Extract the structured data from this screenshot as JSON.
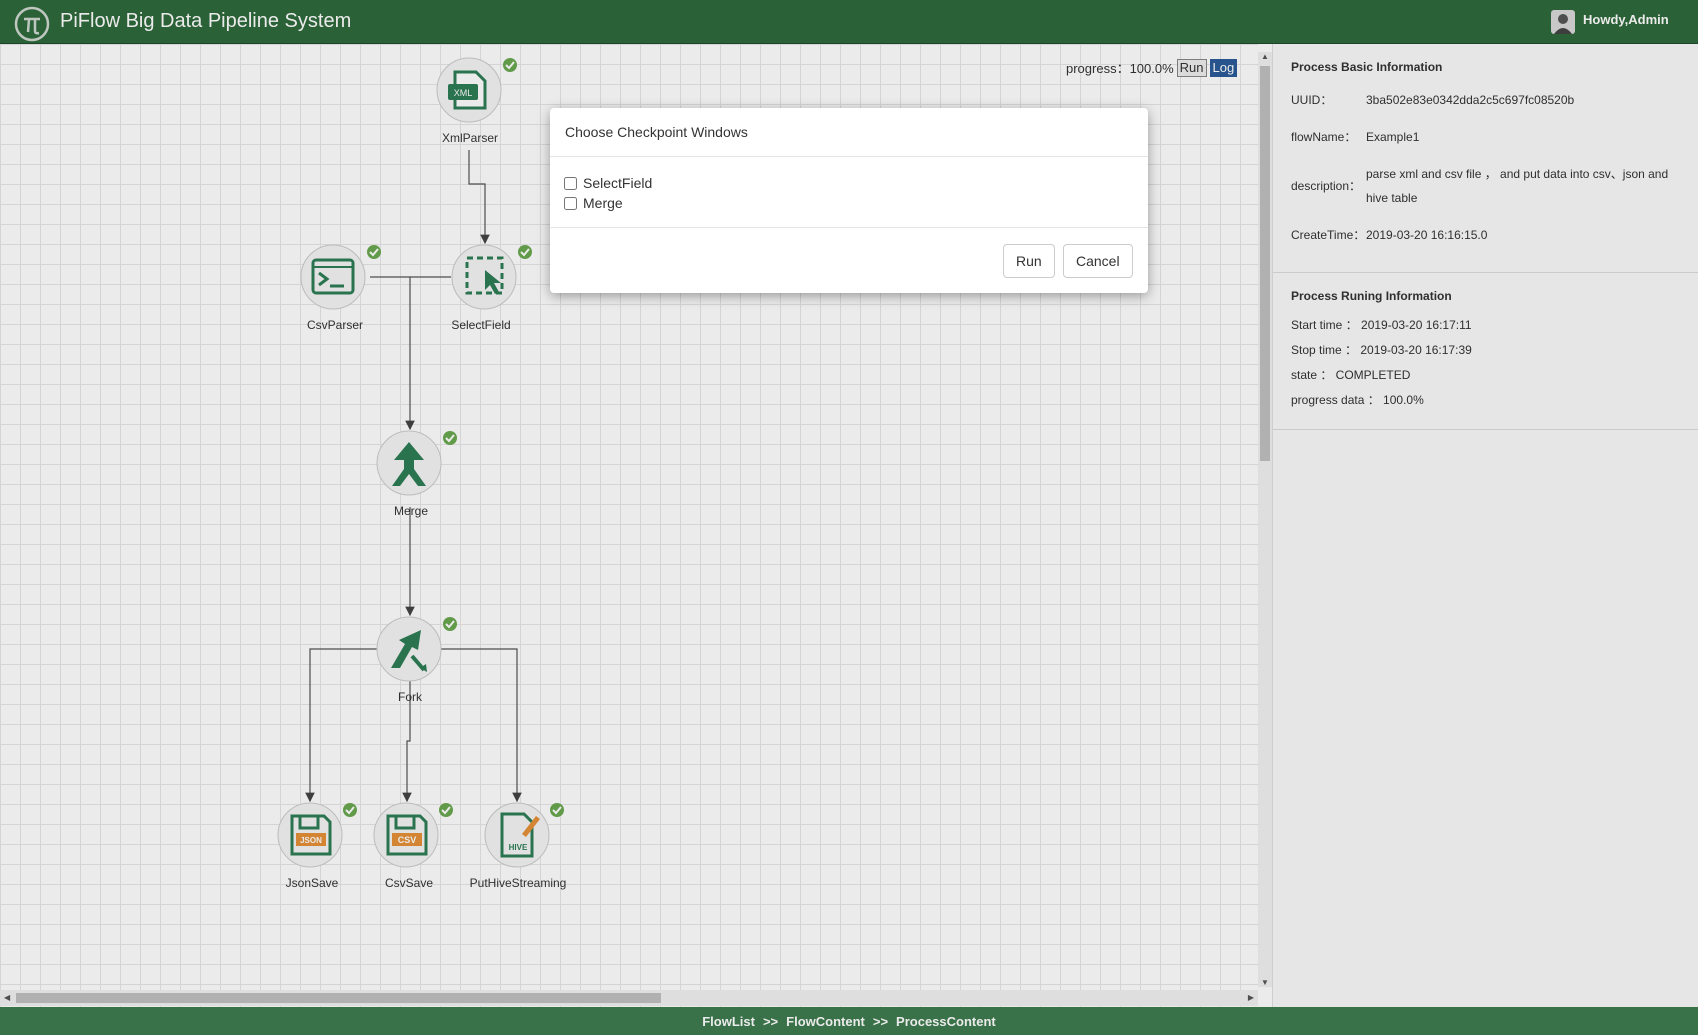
{
  "header": {
    "title": "PiFlow Big Data Pipeline System",
    "greeting": "Howdy,Admin"
  },
  "canvas": {
    "progress_label": "progress：100.0%",
    "run_label": "Run",
    "log_label": "Log",
    "nodes": [
      {
        "name": "XmlParser",
        "icon": "xml-file-icon",
        "status": "done"
      },
      {
        "name": "CsvParser",
        "icon": "terminal-icon",
        "status": "done"
      },
      {
        "name": "SelectField",
        "icon": "select-cursor-icon",
        "status": "done"
      },
      {
        "name": "Merge",
        "icon": "merge-icon",
        "status": "done"
      },
      {
        "name": "Fork",
        "icon": "fork-icon",
        "status": "done"
      },
      {
        "name": "JsonSave",
        "icon": "json-save-icon",
        "status": "done"
      },
      {
        "name": "CsvSave",
        "icon": "csv-save-icon",
        "status": "done"
      },
      {
        "name": "PutHiveStreaming",
        "icon": "hive-icon",
        "status": "done"
      }
    ],
    "edges": [
      [
        "XmlParser",
        "SelectField"
      ],
      [
        "CsvParser",
        "Merge"
      ],
      [
        "SelectField",
        "Merge"
      ],
      [
        "Merge",
        "Fork"
      ],
      [
        "Fork",
        "JsonSave"
      ],
      [
        "Fork",
        "CsvSave"
      ],
      [
        "Fork",
        "PutHiveStreaming"
      ]
    ],
    "icon_text": {
      "xml": "XML",
      "json": "JSON",
      "csv": "CSV",
      "hive": "HIVE"
    }
  },
  "info": {
    "basic_title": "Process Basic Information",
    "uuid_label": "UUID：",
    "uuid": "3ba502e83e0342dda2c5c697fc08520b",
    "flowname_label": "flowName：",
    "flowname": "Example1",
    "description_label": "description：",
    "description": "parse xml and csv file ， and put data into csv、json and hive table",
    "createtime_label": "CreateTime：",
    "createtime": "2019-03-20 16:16:15.0",
    "running_title": "Process Runing Information",
    "start_time": "Start time ： 2019-03-20 16:17:11",
    "stop_time": "Stop time ： 2019-03-20 16:17:39",
    "state": "state ： COMPLETED",
    "progress": "progress data ： 100.0%"
  },
  "modal": {
    "title": "Choose Checkpoint Windows",
    "options": [
      "SelectField",
      "Merge"
    ],
    "run_label": "Run",
    "cancel_label": "Cancel"
  },
  "footer": {
    "crumbs": [
      "FlowList",
      "FlowContent",
      "ProcessContent"
    ],
    "separator": ">>"
  },
  "colors": {
    "header_bg": "#2f6a3c",
    "footer_bg": "#3e7b4f",
    "node_icon": "#2e7d56",
    "status_badge": "#6aa84f"
  }
}
